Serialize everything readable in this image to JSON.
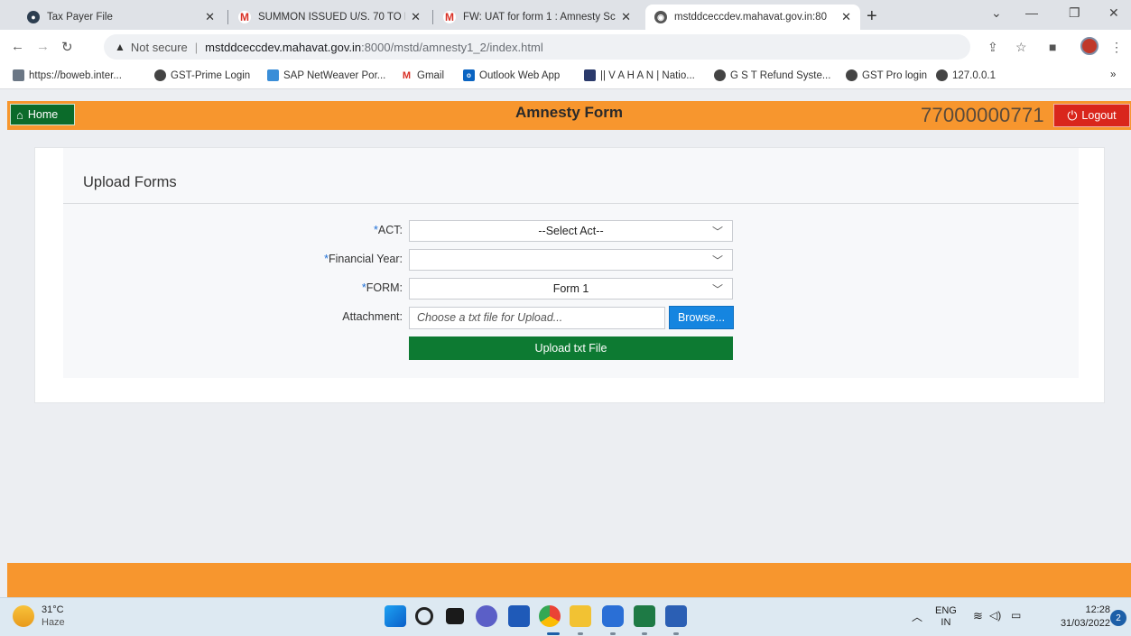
{
  "browser": {
    "tabs": [
      {
        "title": "Tax Payer File",
        "active": false
      },
      {
        "title": "SUMMON ISSUED U/S. 70 TO M/",
        "active": false
      },
      {
        "title": "FW: UAT for form 1 : Amnesty Sc",
        "active": false
      },
      {
        "title": "mstddceccdev.mahavat.gov.in:80",
        "active": true
      }
    ],
    "address": {
      "security": "Not secure",
      "host": "mstddceccdev.mahavat.gov.in",
      "path": ":8000/mstd/amnesty1_2/index.html"
    },
    "bookmarks": [
      "https://boweb.inter...",
      "GST-Prime Login",
      "SAP NetWeaver Por...",
      "Gmail",
      "Outlook Web App",
      "|| V A H A N | Natio...",
      "G S T Refund Syste...",
      "GST Pro login",
      "127.0.0.1"
    ],
    "bookmarks_more": "»"
  },
  "app": {
    "home_label": "Home",
    "title": "Amnesty Form",
    "user_id": "77000000771",
    "logout_label": "Logout",
    "header_color": "#f7962e"
  },
  "form": {
    "section_title": "Upload Forms",
    "required_mark": "*",
    "act": {
      "label": "ACT:",
      "value": "--Select Act--"
    },
    "financial_year": {
      "label": "Financial Year:",
      "value": ""
    },
    "form_type": {
      "label": "FORM:",
      "value": "Form 1"
    },
    "attachment": {
      "label": "Attachment:",
      "placeholder": "Choose a txt file for Upload...",
      "browse_label": "Browse..."
    },
    "upload_label": "Upload txt File"
  },
  "taskbar": {
    "weather_temp": "31°C",
    "weather_desc": "Haze",
    "lang_top": "ENG",
    "lang_bottom": "IN",
    "time": "12:28",
    "date": "31/03/2022",
    "notifications": "2"
  }
}
